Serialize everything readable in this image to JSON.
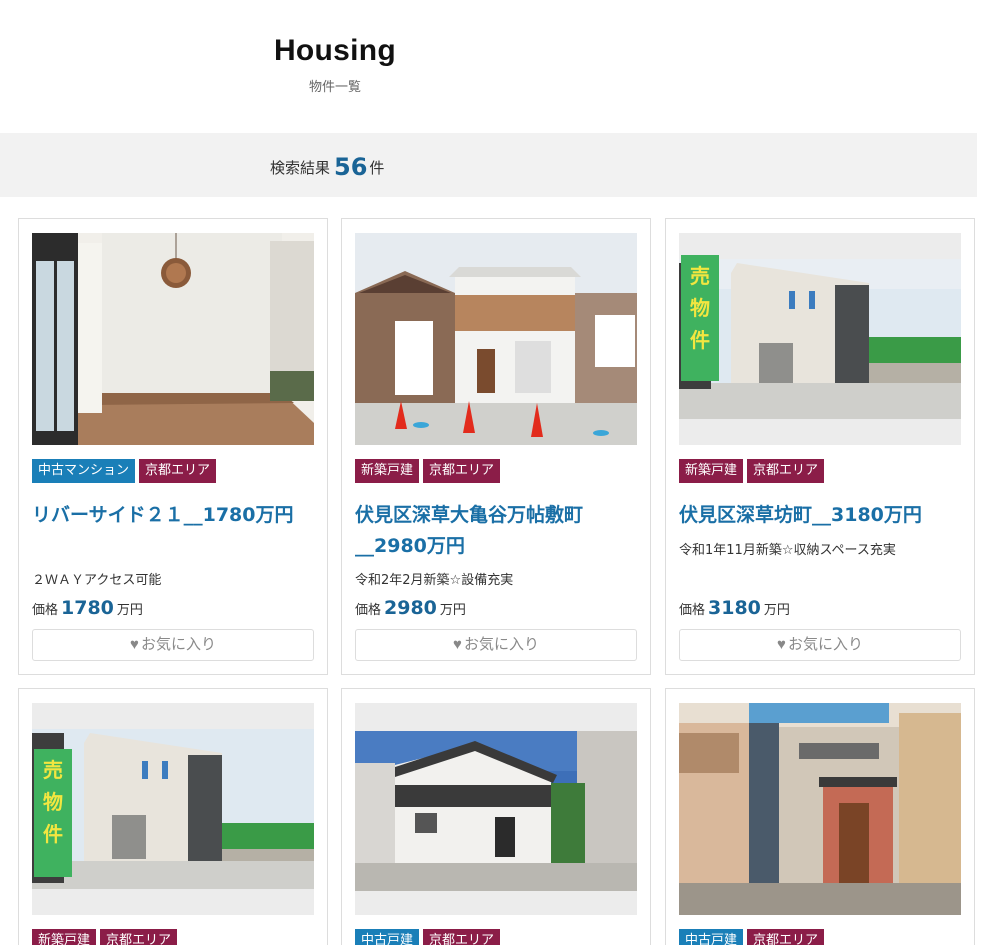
{
  "header": {
    "title": "Housing",
    "subtitle": "物件一覧"
  },
  "search": {
    "prefix": "検索結果",
    "count": "56",
    "suffix": "件"
  },
  "price_prefix": "価格",
  "price_unit": "万円",
  "favorite_label": "お気に入り",
  "listings": [
    {
      "tags": [
        "中古マンション",
        "京都エリア"
      ],
      "title": "リバーサイド２１__1780万円",
      "description": "２ＷＡＹアクセス可能",
      "price": "1780"
    },
    {
      "tags": [
        "新築戸建",
        "京都エリア"
      ],
      "title": "伏見区深草大亀谷万帖敷町__2980万円",
      "description": "令和2年2月新築☆設備充実",
      "price": "2980"
    },
    {
      "tags": [
        "新築戸建",
        "京都エリア"
      ],
      "title": "伏見区深草坊町__3180万円",
      "description": "令和1年11月新築☆収納スペース充実",
      "price": "3180"
    },
    {
      "tags": [
        "新築戸建",
        "京都エリア"
      ]
    },
    {
      "tags": [
        "中古戸建",
        "京都エリア"
      ]
    },
    {
      "tags": [
        "中古戸建",
        "京都エリア"
      ]
    }
  ],
  "colors": {
    "accent": "#1a6fa6",
    "tag_blue": "#1a7fb8",
    "tag_red": "#8b1d48"
  }
}
